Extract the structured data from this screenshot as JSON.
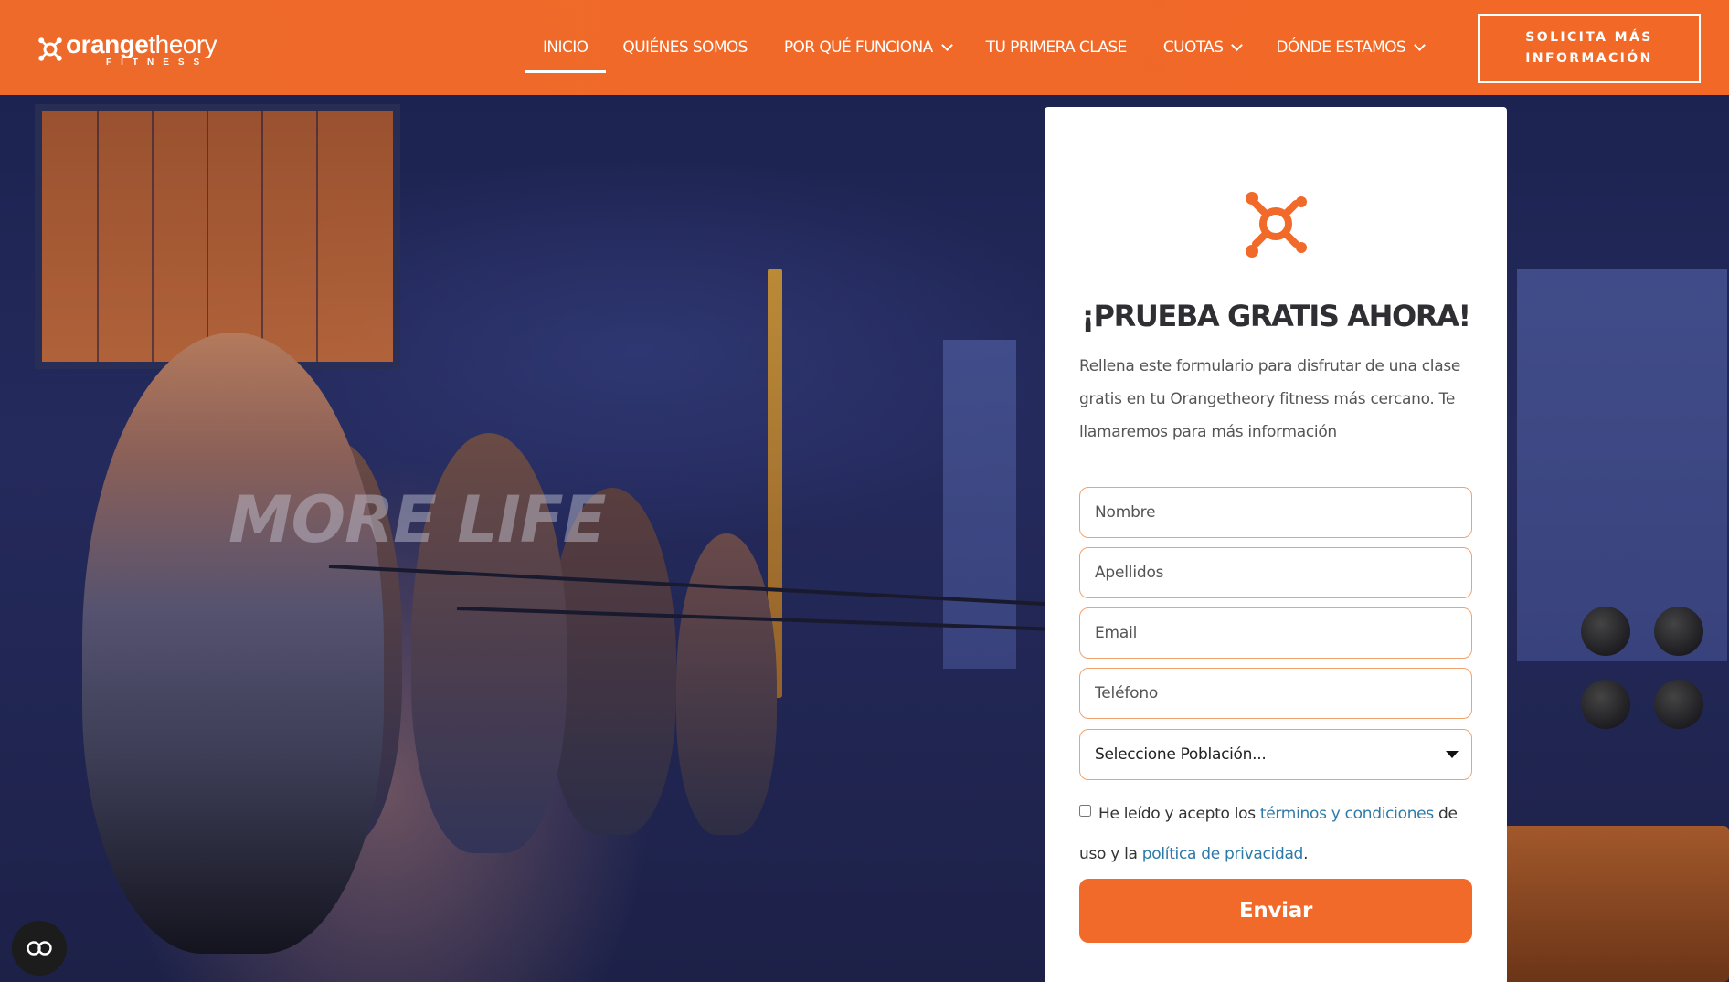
{
  "brand": {
    "name_part1": "orange",
    "name_part2": "theory",
    "sub": "FITNESS",
    "color": "#f26a2a"
  },
  "nav": {
    "items": [
      {
        "label": "INICIO",
        "active": true,
        "dropdown": false
      },
      {
        "label": "QUIÉNES SOMOS",
        "active": false,
        "dropdown": false
      },
      {
        "label": "POR QUÉ FUNCIONA",
        "active": false,
        "dropdown": true
      },
      {
        "label": "TU PRIMERA CLASE",
        "active": false,
        "dropdown": false
      },
      {
        "label": "CUOTAS",
        "active": false,
        "dropdown": true
      },
      {
        "label": "DÓNDE ESTAMOS",
        "active": false,
        "dropdown": true
      }
    ],
    "cta_line1": "SOLICITA MÁS",
    "cta_line2": "INFORMACIÓN"
  },
  "hero": {
    "slogan": "MORE LIFE"
  },
  "form": {
    "title": "¡PRUEBA GRATIS AHORA!",
    "description": "Rellena este formulario para disfrutar de una clase gratis en tu Orangetheory fitness más cercano. Te llamaremos para más información",
    "fields": {
      "nombre": "Nombre",
      "apellidos": "Apellidos",
      "email": "Email",
      "telefono": "Teléfono"
    },
    "select_placeholder": "Seleccione Población...",
    "consent_prefix": "He leído y acepto los ",
    "consent_link1": "términos y condiciones",
    "consent_mid": " de uso y la ",
    "consent_link2": "política de privacidad",
    "consent_suffix": ".",
    "consent_checked": false,
    "submit_label": "Enviar"
  },
  "accessibility": {
    "icon": "accessibility-toggle-icon"
  },
  "colors": {
    "accent": "#f26a2a",
    "field_border": "#f0a26f",
    "link": "#2d7aa8"
  }
}
